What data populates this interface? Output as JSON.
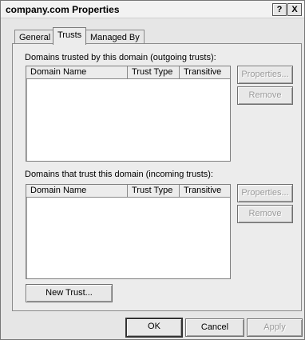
{
  "window": {
    "title": "company.com Properties",
    "help_label": "?",
    "close_label": "X"
  },
  "tabs": [
    {
      "label": "General"
    },
    {
      "label": "Trusts"
    },
    {
      "label": "Managed By"
    }
  ],
  "outgoing": {
    "label": "Domains trusted by this domain (outgoing trusts):",
    "columns": [
      "Domain Name",
      "Trust Type",
      "Transitive"
    ],
    "rows": [],
    "properties_label": "Properties...",
    "remove_label": "Remove"
  },
  "incoming": {
    "label": "Domains that trust this domain (incoming trusts):",
    "columns": [
      "Domain Name",
      "Trust Type",
      "Transitive"
    ],
    "rows": [],
    "properties_label": "Properties...",
    "remove_label": "Remove"
  },
  "new_trust_label": "New Trust...",
  "footer": {
    "ok_label": "OK",
    "cancel_label": "Cancel",
    "apply_label": "Apply"
  }
}
